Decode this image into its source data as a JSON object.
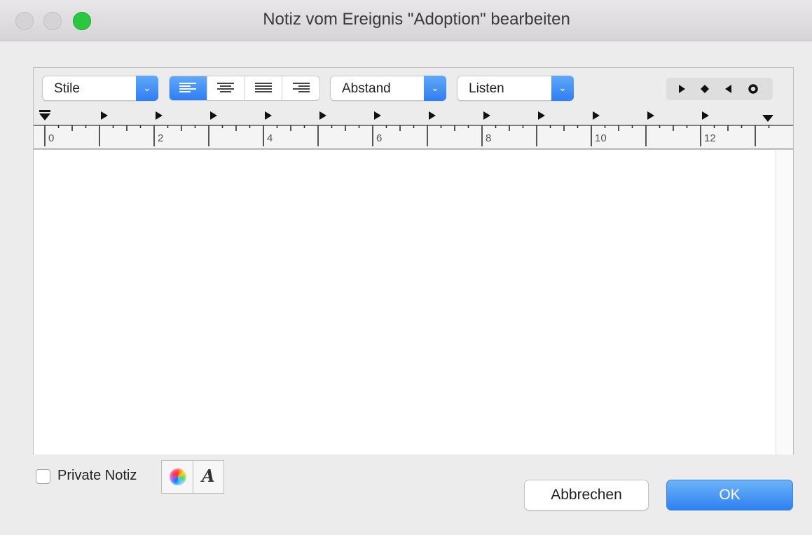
{
  "window": {
    "title": "Notiz vom Ereignis \"Adoption\" bearbeiten"
  },
  "toolbar": {
    "styles_label": "Stile",
    "spacing_label": "Abstand",
    "lists_label": "Listen",
    "alignment_options": [
      "align-left",
      "align-center",
      "align-justify",
      "align-right"
    ],
    "alignment_selected": "align-left",
    "tab_stop_types": [
      "left-tab",
      "center-tab",
      "right-tab",
      "decimal-tab"
    ]
  },
  "ruler": {
    "numbers": [
      "0",
      "2",
      "4",
      "6",
      "8",
      "10",
      "12"
    ]
  },
  "editor": {
    "content": ""
  },
  "footer": {
    "private_label": "Private Notiz",
    "private_checked": false,
    "color_icon": "color-wheel-icon",
    "font_icon": "font-icon",
    "font_glyph": "A",
    "cancel_label": "Abbrechen",
    "ok_label": "OK"
  },
  "colors": {
    "accent": "#2f7ef4",
    "zoom_button": "#2ac840"
  }
}
